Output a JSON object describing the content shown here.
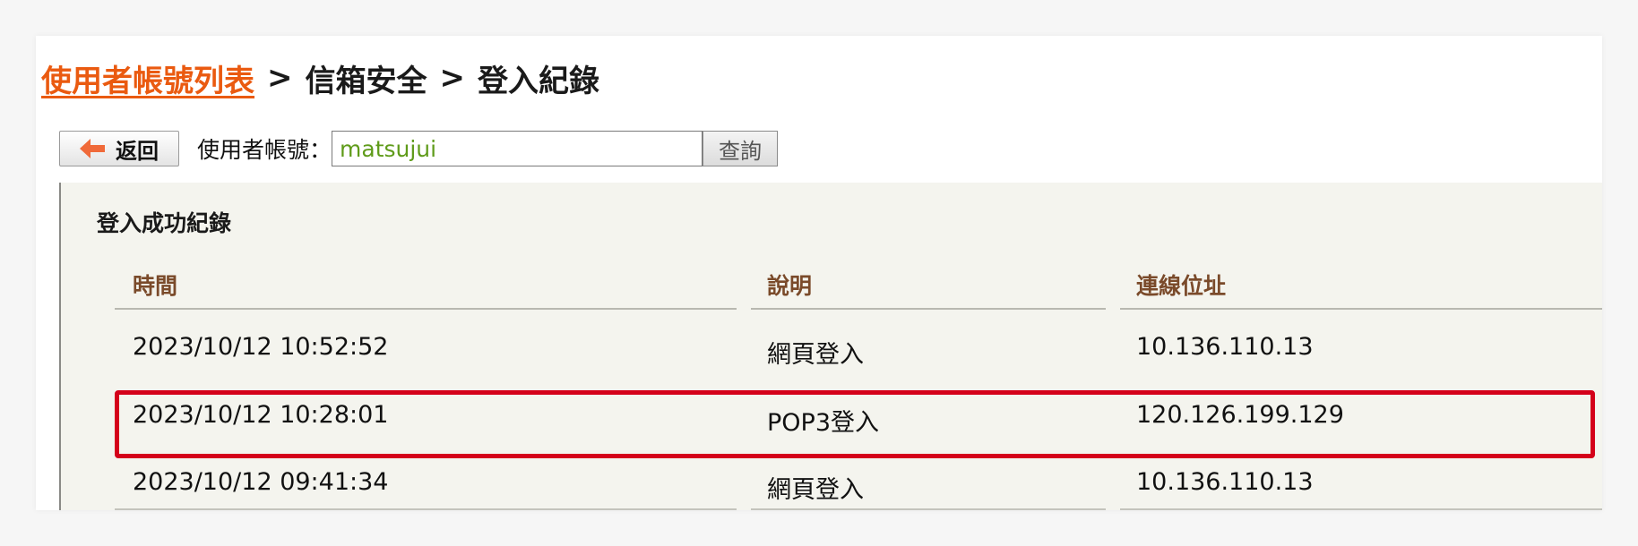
{
  "breadcrumb": {
    "link": "使用者帳號列表",
    "sep1": ">",
    "item2": "信箱安全",
    "sep2": ">",
    "current": "登入紀錄"
  },
  "toolbar": {
    "back_label": "返回",
    "account_label": "使用者帳號：",
    "account_value": "matsujui",
    "query_label": "查詢"
  },
  "section": {
    "title": "登入成功紀錄"
  },
  "table": {
    "headers": [
      "時間",
      "說明",
      "連線位址"
    ],
    "rows": [
      [
        "2023/10/12 10:52:52",
        "網頁登入",
        "10.136.110.13"
      ],
      [
        "2023/10/12 10:28:01",
        "POP3登入",
        "120.126.199.129"
      ],
      [
        "2023/10/12 09:41:34",
        "網頁登入",
        "10.136.110.13"
      ]
    ]
  },
  "colors": {
    "link": "#ea5a10",
    "header_text": "#7a4a2a",
    "highlight": "#d4001a",
    "input_text": "#5f9b1a"
  }
}
